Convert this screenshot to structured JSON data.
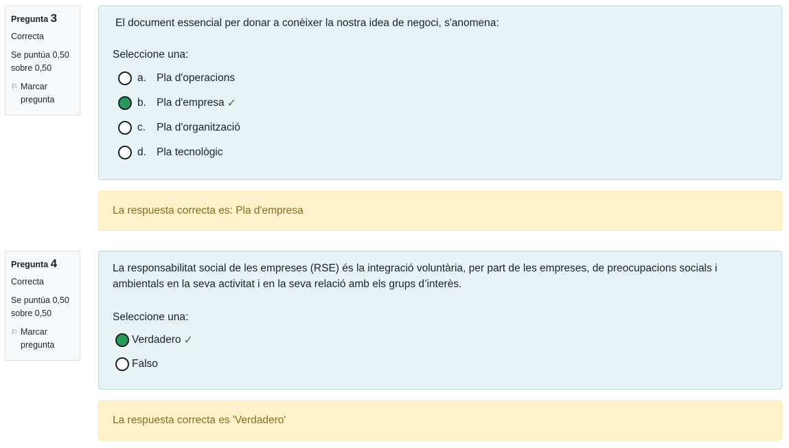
{
  "questions": [
    {
      "label": "Pregunta",
      "number": "3",
      "state": "Correcta",
      "grade": "Se puntúa 0,50 sobre 0,50",
      "flag": "Marcar pregunta",
      "text": "El document essencial per donar a conèixer la nostra idea de negoci, s'anomena:",
      "prompt": "Seleccione una:",
      "options": [
        {
          "letter": "a.",
          "label": "Pla d'operacions",
          "selected": false
        },
        {
          "letter": "b.",
          "label": "Pla d'empresa",
          "selected": true
        },
        {
          "letter": "c.",
          "label": "Pla d'organització",
          "selected": false
        },
        {
          "letter": "d.",
          "label": "Pla tecnològic",
          "selected": false
        }
      ],
      "feedback": "La respuesta correcta es: Pla d'empresa"
    },
    {
      "label": "Pregunta",
      "number": "4",
      "state": "Correcta",
      "grade": "Se puntúa 0,50 sobre 0,50",
      "flag": "Marcar pregunta",
      "text": "La responsabilitat social de les empreses (RSE) és la integració voluntària, per part de les empreses, de preocupacions socials i ambientals en la seva activitat i en la seva relació amb els grups d’interès.",
      "prompt": "Seleccione una:",
      "options": [
        {
          "label": "Verdadero",
          "selected": true
        },
        {
          "label": "Falso",
          "selected": false
        }
      ],
      "feedback": "La respuesta correcta es 'Verdadero'"
    }
  ],
  "icons": {
    "flag": "flag-icon",
    "correct": "check-icon"
  },
  "colors": {
    "info_bg": "#f8f9fa",
    "content_bg": "#e7f3f5",
    "feedback_bg": "#fff1c9",
    "feedback_text": "#8a6d1f",
    "selected_radio": "#2a9a5a",
    "check": "#357a32"
  }
}
